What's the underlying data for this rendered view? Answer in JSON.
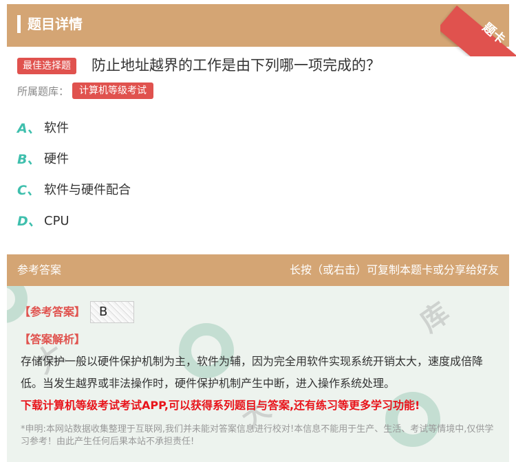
{
  "header": {
    "title": "题目详情",
    "ribbon_label": "题卡",
    "accent_color": "#d4a574",
    "ribbon_color": "#e0524e"
  },
  "question": {
    "type_badge": "最佳选择题",
    "text": "防止地址越界的工作是由下列哪一项完成的？",
    "source_label": "所属题库：",
    "source_value": "计算机等级考试"
  },
  "options": [
    {
      "letter": "A、",
      "text": "软件"
    },
    {
      "letter": "B、",
      "text": "硬件"
    },
    {
      "letter": "C、",
      "text": "软件与硬件配合"
    },
    {
      "letter": "D、",
      "text": "CPU"
    }
  ],
  "answer": {
    "panel_title": "参考答案",
    "panel_hint": "长按（或右击）可复制本题卡或分享给好友",
    "ref_label": "【参考答案】",
    "ref_value": "B",
    "analysis_label": "【答案解析】",
    "analysis_text": "存储保护一般以硬件保护机制为主，软件为辅，因为完全用软件实现系统开销太大，速度成倍降低。当发生越界或非法操作时，硬件保护机制产生中断，进入操作系统处理。",
    "promo": "下载计算机等级考试考试APP,可以获得系列题目与答案,还有练习等更多学习功能!",
    "disclaimer": "*申明:本网站数据收集整理于互联网,我们并未能对答案信息进行校对!本信息不能用于生产、生活、考试等情境中,仅供学习参考！由此产生任何后果本站不承担责任!",
    "option_letter_color": "#3fbfad",
    "highlight_color": "#e0524e"
  }
}
